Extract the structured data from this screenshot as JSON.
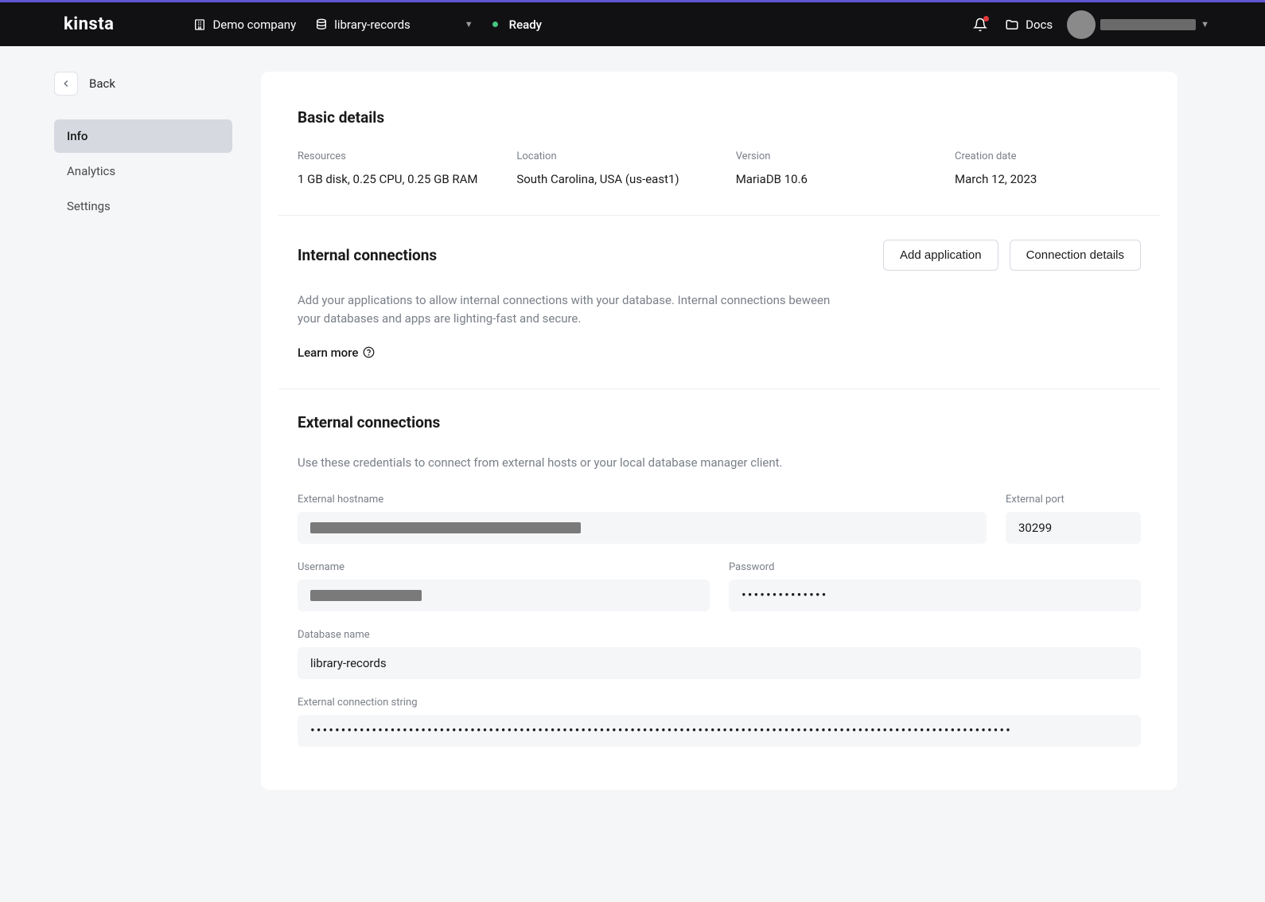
{
  "header": {
    "logo": "kinsta",
    "company": "Demo company",
    "database": "library-records",
    "status": "Ready",
    "docs": "Docs"
  },
  "sidebar": {
    "back": "Back",
    "items": [
      {
        "label": "Info",
        "active": true
      },
      {
        "label": "Analytics",
        "active": false
      },
      {
        "label": "Settings",
        "active": false
      }
    ]
  },
  "basic": {
    "title": "Basic details",
    "resources_label": "Resources",
    "resources_value": "1 GB disk, 0.25 CPU, 0.25 GB RAM",
    "location_label": "Location",
    "location_value": "South Carolina, USA (us-east1)",
    "version_label": "Version",
    "version_value": "MariaDB 10.6",
    "creation_label": "Creation date",
    "creation_value": "March 12, 2023"
  },
  "internal": {
    "title": "Internal connections",
    "add_app": "Add application",
    "conn_details": "Connection details",
    "desc": "Add your applications to allow internal connections with your database. Internal connections beween your databases and apps are lighting-fast and secure.",
    "learn_more": "Learn more"
  },
  "external": {
    "title": "External connections",
    "desc": "Use these credentials to connect from external hosts or your local database manager client.",
    "hostname_label": "External hostname",
    "port_label": "External port",
    "port_value": "30299",
    "username_label": "Username",
    "password_label": "Password",
    "password_value": "••••••••••••••",
    "dbname_label": "Database name",
    "dbname_value": "library-records",
    "connstr_label": "External connection string",
    "connstr_value": "••••••••••••••••••••••••••••••••••••••••••••••••••••••••••••••••••••••••••••••••••••••••••••••••••••••••••••••••••"
  }
}
